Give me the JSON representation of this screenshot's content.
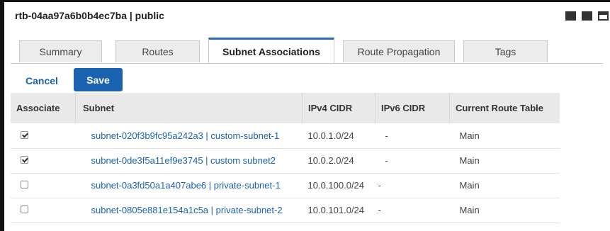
{
  "header": {
    "title": "rtb-04aa97a6b0b4ec7ba | public"
  },
  "panel_icons": [
    "split-bottom-icon",
    "split-top-icon",
    "maximize-icon"
  ],
  "tabs": [
    {
      "label": "Summary",
      "active": false
    },
    {
      "label": "Routes",
      "active": false
    },
    {
      "label": "Subnet Associations",
      "active": true
    },
    {
      "label": "Route Propagation",
      "active": false
    },
    {
      "label": "Tags",
      "active": false
    }
  ],
  "actions": {
    "cancel_label": "Cancel",
    "save_label": "Save"
  },
  "table": {
    "columns": [
      "Associate",
      "Subnet",
      "IPv4 CIDR",
      "IPv6 CIDR",
      "Current Route Table"
    ],
    "rows": [
      {
        "checked": true,
        "subnet": "subnet-020f3b9fc95a242a3 | custom-subnet-1",
        "ipv4": "10.0.1.0/24",
        "ipv6": "-",
        "route_table": "Main"
      },
      {
        "checked": true,
        "subnet": "subnet-0de3f5a11ef9e3745 | custom subnet2",
        "ipv4": "10.0.2.0/24",
        "ipv6": "-",
        "route_table": "Main"
      },
      {
        "checked": false,
        "subnet": "subnet-0a3fd50a1a407abe6 | private-subnet-1",
        "ipv4": "10.0.100.0/24",
        "ipv6": "-",
        "route_table": "Main"
      },
      {
        "checked": false,
        "subnet": "subnet-0805e881e154a1c5a | private-subnet-2",
        "ipv4": "10.0.101.0/24",
        "ipv6": "-",
        "route_table": "Main"
      }
    ]
  },
  "colors": {
    "accent": "#1a63b0",
    "header_bg": "#e9e9e9",
    "tab_bg": "#ececec"
  }
}
